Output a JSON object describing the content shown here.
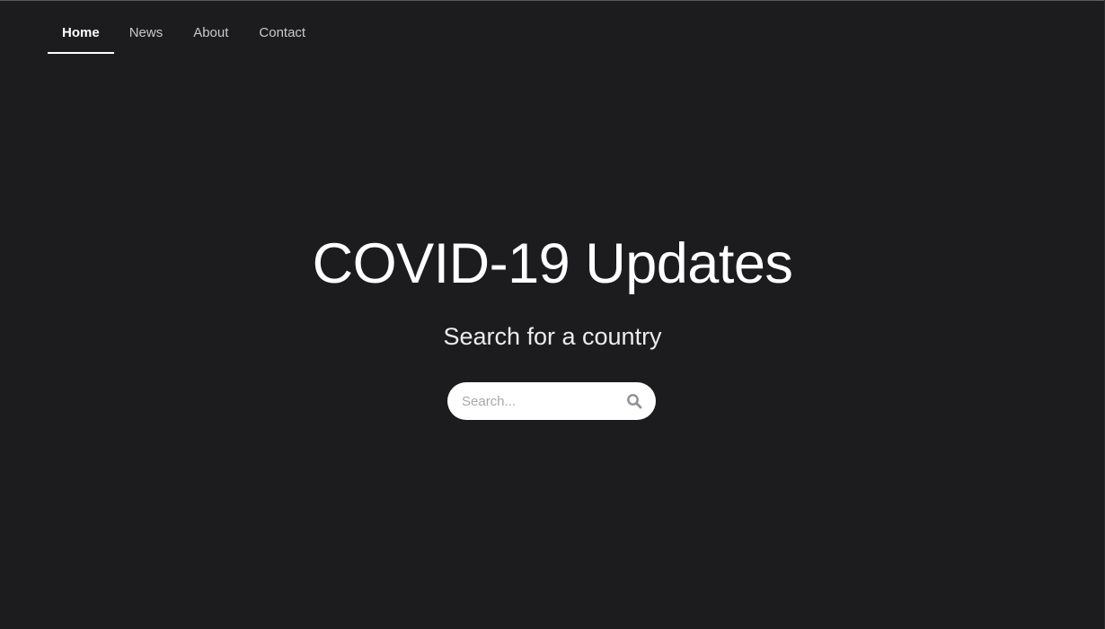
{
  "nav": {
    "items": [
      {
        "label": "Home",
        "active": true
      },
      {
        "label": "News",
        "active": false
      },
      {
        "label": "About",
        "active": false
      },
      {
        "label": "Contact",
        "active": false
      }
    ]
  },
  "hero": {
    "title": "COVID-19 Updates",
    "subtitle": "Search for a country"
  },
  "search": {
    "placeholder": "Search...",
    "value": "",
    "icon": "search-icon"
  },
  "colors": {
    "background": "#1c1c1e",
    "text": "#ffffff",
    "nav_inactive": "#c9c9cb",
    "search_bg": "#ffffff",
    "icon": "#8e8e93"
  }
}
